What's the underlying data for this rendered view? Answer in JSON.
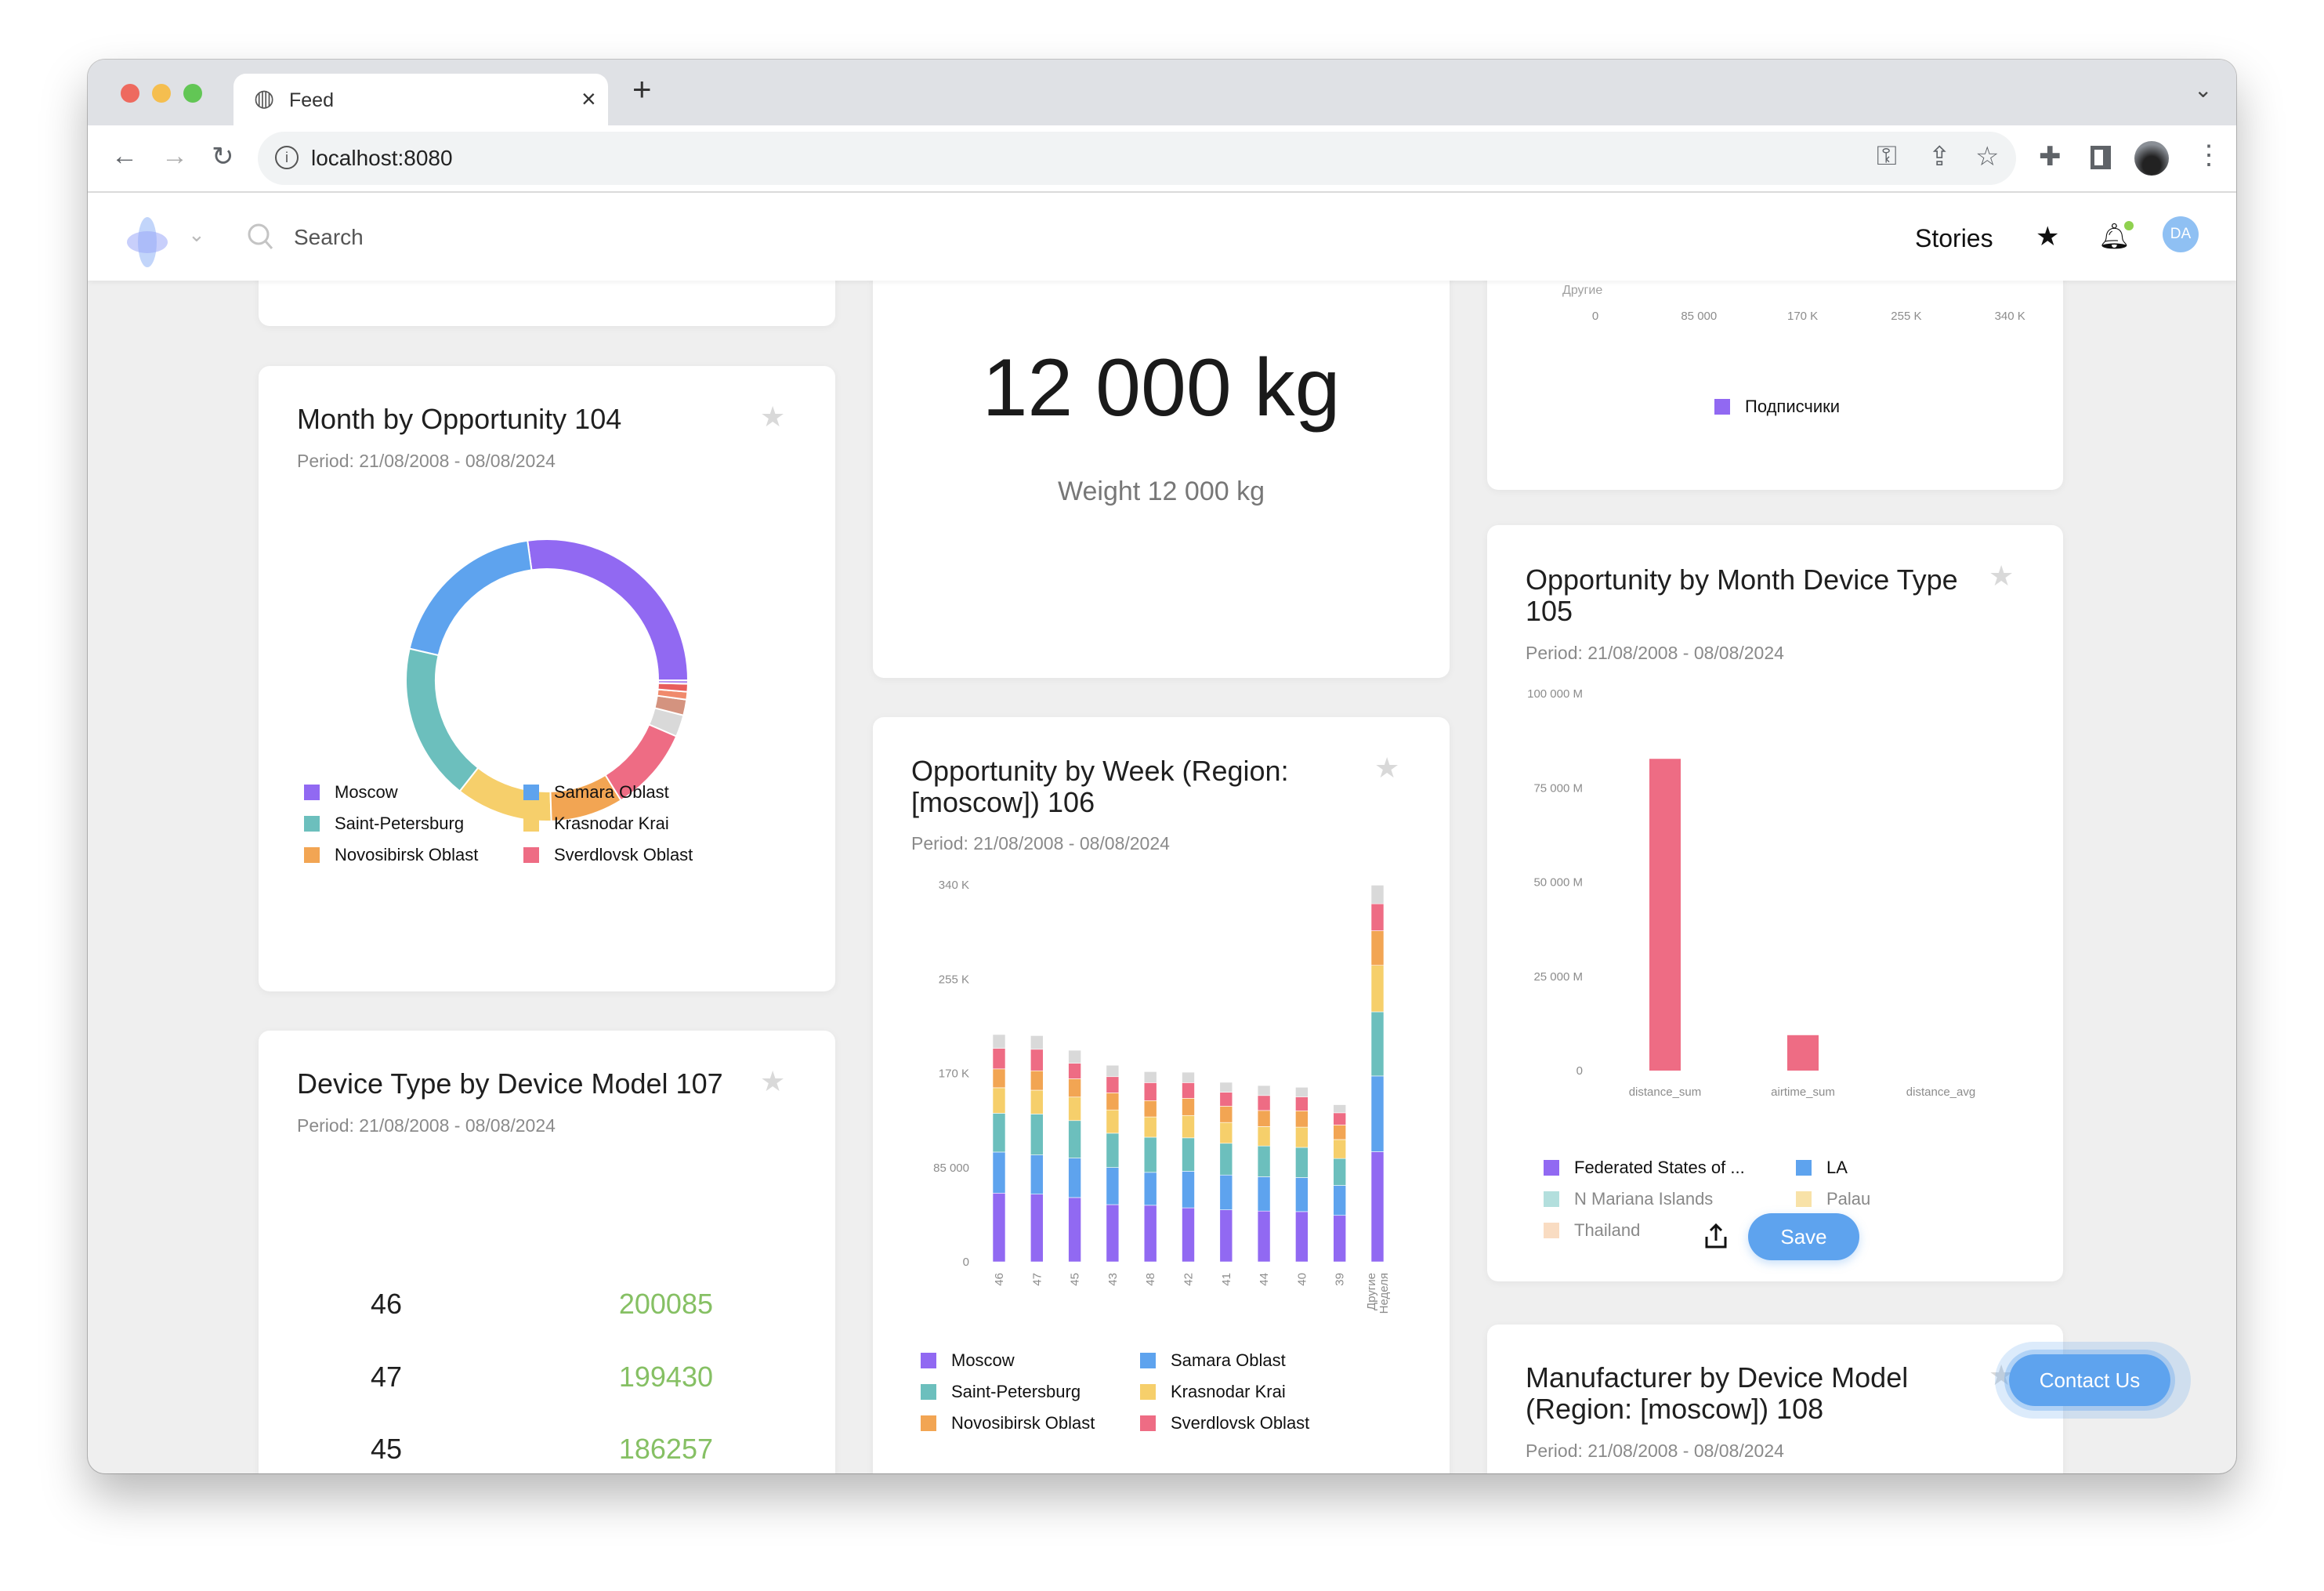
{
  "browser": {
    "tab_title": "Feed",
    "url": "localhost:8080",
    "new_tab": "+",
    "close": "×"
  },
  "app": {
    "search_placeholder": "Search",
    "stories": "Stories",
    "avatar_initials": "DA",
    "contact_us": "Contact Us"
  },
  "colors": {
    "purple": "#9169f2",
    "blue": "#5ea3ee",
    "teal": "#6cbfbd",
    "yellow": "#f6cf6b",
    "orange": "#f2a553",
    "pink": "#ee6c84",
    "other": "#d9d9d9",
    "accent": "#5ea3ee",
    "value_green": "#86c064"
  },
  "cards": {
    "donut": {
      "title": "Month by Opportunity 104",
      "period": "Period: 21/08/2008 - 08/08/2024"
    },
    "kpi": {
      "value": "12 000 kg",
      "caption": "Weight 12 000 kg"
    },
    "weekly": {
      "title": "Opportunity by Week (Region: [moscow]) 106",
      "period": "Period: 21/08/2008 - 08/08/2024"
    },
    "subs": {
      "other_label": "Другие"
    },
    "device_month": {
      "title": "Opportunity by Month Device Type 105",
      "period": "Period: 21/08/2008 - 08/08/2024",
      "save": "Save"
    },
    "table": {
      "title": "Device Type by Device Model 107",
      "period": "Period: 21/08/2008 - 08/08/2024",
      "rows": [
        {
          "key": "46",
          "value": "200085"
        },
        {
          "key": "47",
          "value": "199430"
        },
        {
          "key": "45",
          "value": "186257"
        }
      ]
    },
    "manufacturer": {
      "title": "Manufacturer by Device Model (Region: [moscow]) 108",
      "period": "Period: 21/08/2008 - 08/08/2024"
    }
  },
  "chart_data": [
    {
      "type": "pie",
      "donut": true,
      "categories": [
        "Moscow",
        "Samara Oblast",
        "Saint-Petersburg",
        "Krasnodar Krai",
        "Novosibirsk Oblast",
        "Sverdlovsk Oblast",
        "",
        "",
        "",
        "",
        ""
      ],
      "values": [
        27.2,
        19.2,
        18.0,
        11.1,
        8.3,
        9.7,
        2.5,
        1.8,
        0.9,
        0.9,
        0.4
      ],
      "colors": [
        "#9169f2",
        "#5ea3ee",
        "#6cbfbd",
        "#f6cf6b",
        "#f2a553",
        "#ee6c84",
        "#d9d9d9",
        "#d4937f",
        "#f08a6c",
        "#e85d5d",
        "#b58ff0"
      ],
      "legend": [
        "Moscow",
        "Samara Oblast",
        "Saint-Petersburg",
        "Krasnodar Krai",
        "Novosibirsk Oblast",
        "Sverdlovsk Oblast"
      ],
      "legend_placement": "bottom"
    },
    {
      "type": "bar",
      "stacked": true,
      "categories": [
        "46",
        "47",
        "45",
        "43",
        "48",
        "42",
        "41",
        "44",
        "40",
        "39",
        "Другие Неделя"
      ],
      "yticks": [
        "0",
        "85 000",
        "170 K",
        "255 K",
        "340 K"
      ],
      "ylim": [
        0,
        340000
      ],
      "series": [
        {
          "name": "Moscow",
          "color": "#9169f2",
          "values": [
            62000,
            61000,
            58000,
            51600,
            51000,
            48700,
            46900,
            45800,
            45300,
            41900,
            99300
          ]
        },
        {
          "name": "Samara Oblast",
          "color": "#5ea3ee",
          "values": [
            37000,
            35400,
            35600,
            33500,
            29700,
            33000,
            31400,
            30900,
            30700,
            27000,
            68300
          ]
        },
        {
          "name": "Saint-Petersburg",
          "color": "#6cbfbd",
          "values": [
            35000,
            36900,
            33800,
            30900,
            31700,
            30100,
            28600,
            27800,
            27200,
            24300,
            57900
          ]
        },
        {
          "name": "Krasnodar Krai",
          "color": "#f6cf6b",
          "values": [
            23000,
            21500,
            21200,
            21000,
            18300,
            20200,
            18800,
            17500,
            18300,
            17100,
            41900
          ]
        },
        {
          "name": "Novosibirsk Oblast",
          "color": "#f2a553",
          "values": [
            17000,
            17500,
            16500,
            15400,
            14700,
            15500,
            14700,
            14500,
            14700,
            13100,
            31200
          ]
        },
        {
          "name": "Sverdlovsk Oblast",
          "color": "#ee6c84",
          "values": [
            18500,
            19400,
            14000,
            14600,
            16200,
            14100,
            12600,
            13500,
            12600,
            11000,
            24300
          ]
        },
        {
          "color": "#d9d9d9",
          "values": [
            12500,
            12300,
            11700,
            10300,
            9900,
            9400,
            8900,
            9000,
            8600,
            7300,
            16800
          ]
        }
      ],
      "legend_placement": "bottom"
    },
    {
      "type": "bar",
      "orientation": "horizontal",
      "xticks": [
        "0",
        "85 000",
        "170 K",
        "255 K",
        "340 K"
      ],
      "xlim": [
        0,
        340000
      ],
      "legend": [
        "Подписчики"
      ],
      "legend_color": "#9169f2"
    },
    {
      "type": "bar",
      "categories": [
        "distance_sum",
        "airtime_sum",
        "distance_avg"
      ],
      "yticks": [
        "0",
        "25 000 M",
        "50 000 M",
        "75 000 M",
        "100 000 M"
      ],
      "ylim": [
        0,
        100000
      ],
      "series": [
        {
          "color": "#ee6c84",
          "values": [
            82700,
            9400,
            0
          ]
        }
      ],
      "legend": [
        {
          "name": "Federated States of ...",
          "color": "#9169f2"
        },
        {
          "name": "LA",
          "color": "#5ea3ee"
        },
        {
          "name": "N Mariana Islands",
          "color": "#b3dfdd"
        },
        {
          "name": "Palau",
          "color": "#f8e2a8"
        },
        {
          "name": "Thailand",
          "color": "#f9dcc2"
        }
      ]
    }
  ]
}
